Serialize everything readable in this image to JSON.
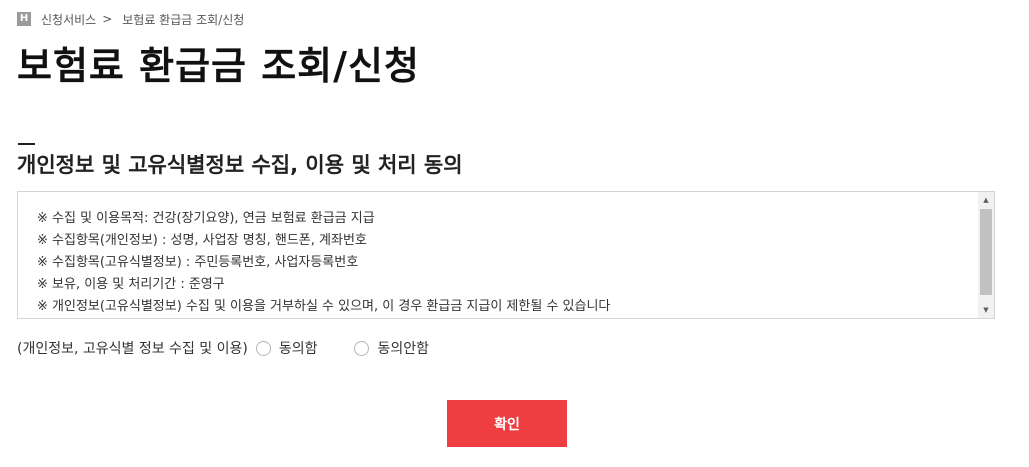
{
  "breadcrumb": {
    "home_icon": "H",
    "items": [
      "신청서비스",
      "보험료 환급금 조회/신청"
    ],
    "separator": ">"
  },
  "page": {
    "title": "보험료 환급금 조회/신청"
  },
  "section": {
    "title": "개인정보 및 고유식별정보 수집, 이용 및 처리 동의"
  },
  "terms": {
    "lines": [
      "※ 수집 및 이용목적: 건강(장기요양), 연금 보험료 환급금 지급",
      "※ 수집항목(개인정보) : 성명, 사업장 명칭, 핸드폰, 계좌번호",
      "※ 수집항목(고유식별정보) : 주민등록번호, 사업자등록번호",
      "※ 보유, 이용 및 처리기간 : 준영구",
      "※ 개인정보(고유식별정보) 수집 및 이용을 거부하실 수 있으며, 이 경우 환급금 지급이 제한될 수 있습니다"
    ]
  },
  "consent": {
    "label": "(개인정보, 고유식별 정보 수집 및 이용)",
    "agree_label": "동의함",
    "disagree_label": "동의안함",
    "selected": null
  },
  "confirm_button": {
    "label": "확인",
    "color": "#ef3e42"
  },
  "icons": {
    "home": "home-icon",
    "scroll_up": "scroll-up-arrow-icon",
    "scroll_down": "scroll-down-arrow-icon"
  }
}
